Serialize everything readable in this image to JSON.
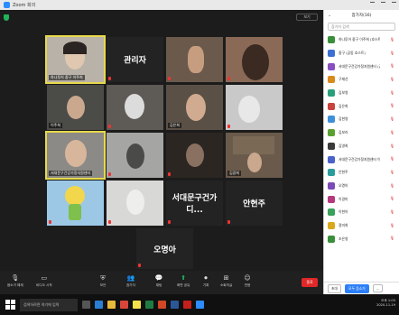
{
  "window": {
    "title": "Zoom 회의"
  },
  "meeting": {
    "view_label": "보기",
    "tiles": [
      {
        "label": "하나투어 중구 이주희",
        "big": ""
      },
      {
        "label": "",
        "big": "관리자"
      },
      {
        "label": "",
        "big": ""
      },
      {
        "label": "",
        "big": ""
      },
      {
        "label": "이주희",
        "big": ""
      },
      {
        "label": "",
        "big": ""
      },
      {
        "label": "김은희",
        "big": ""
      },
      {
        "label": "",
        "big": ""
      },
      {
        "label": "서대문구건강가정지원센터",
        "big": ""
      },
      {
        "label": "",
        "big": ""
      },
      {
        "label": "",
        "big": ""
      },
      {
        "label": "김광희",
        "big": ""
      },
      {
        "label": "",
        "big": ""
      },
      {
        "label": "",
        "big": ""
      },
      {
        "label": "",
        "big": "서대문구건가디..."
      },
      {
        "label": "",
        "big": "안현주"
      },
      {
        "label": "",
        "big": "오명아"
      }
    ]
  },
  "toolbar": {
    "items": [
      "음소거 해제",
      "비디오 시작",
      "보안",
      "참가자",
      "채팅",
      "화면 공유",
      "기록",
      "소회의실",
      "반응"
    ],
    "end_label": "종료"
  },
  "panel": {
    "title": "참가자(16)",
    "search_placeholder": "참가자 검색",
    "participants": [
      {
        "name": "하나투어 중구 이주희 (호스트, 나)",
        "color": "#3a8f3a"
      },
      {
        "name": "중구 (공동 호스트)",
        "color": "#3b6fd1"
      },
      {
        "name": "서대문구건강가정지원센터 (공동 호스트)",
        "color": "#8a4fbf"
      },
      {
        "name": "구재선",
        "color": "#d98a1c"
      },
      {
        "name": "김보영",
        "color": "#2aa07a"
      },
      {
        "name": "김은희",
        "color": "#c9423c"
      },
      {
        "name": "김현영",
        "color": "#3e8fd9"
      },
      {
        "name": "김보라",
        "color": "#5aa031"
      },
      {
        "name": "김영희",
        "color": "#3a3a3a"
      },
      {
        "name": "서대문구건강가정지원센터 이희경",
        "color": "#4a62c9"
      },
      {
        "name": "안현주",
        "color": "#2a9c9c"
      },
      {
        "name": "오명아",
        "color": "#7b4bb5"
      },
      {
        "name": "이경미",
        "color": "#b53a7b"
      },
      {
        "name": "이현아",
        "color": "#3aa05a"
      },
      {
        "name": "정미희",
        "color": "#d9a81c"
      },
      {
        "name": "조은영",
        "color": "#3a8f3a"
      }
    ],
    "invite_label": "초대",
    "mute_all_label": "모두 음소거",
    "more_label": "..."
  },
  "taskbar": {
    "search_placeholder": "검색하려면 여기에 입력",
    "time": "오후 1:05",
    "date": "2020-11-19"
  }
}
